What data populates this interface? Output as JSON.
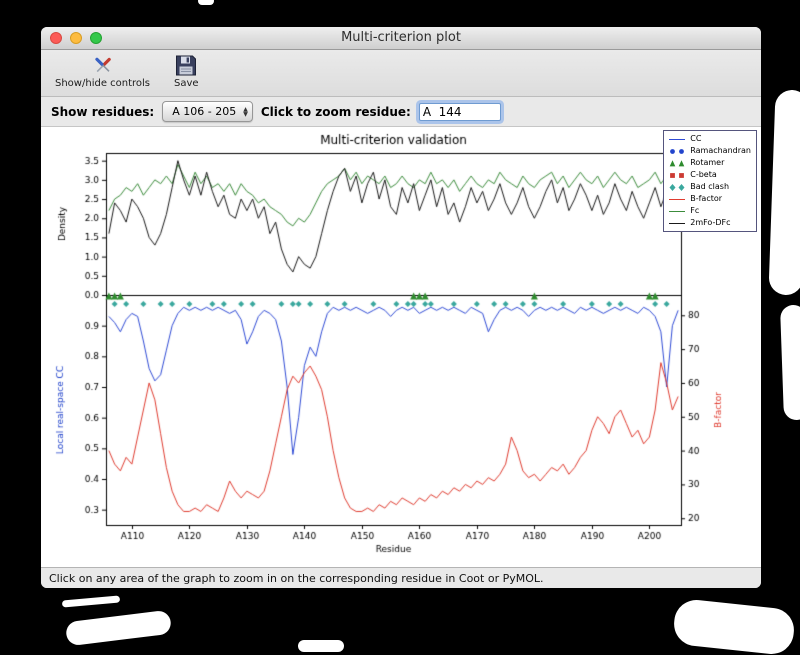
{
  "window": {
    "title": "Multi-criterion plot",
    "toolbar": {
      "show_hide_label": "Show/hide controls",
      "save_label": "Save"
    },
    "controls": {
      "show_residues_label": "Show residues:",
      "residue_range_value": "A 106 - 205",
      "zoom_label": "Click to zoom residue:",
      "zoom_value": "A  144"
    },
    "status_text": "Click on any area of the graph to zoom in on the corresponding residue in Coot or PyMOL."
  },
  "chart_data": {
    "type": "line",
    "title": "Multi-criterion validation",
    "xlabel": "Residue",
    "x_start": 106,
    "x_step": 1,
    "xlim": [
      105.5,
      205.5
    ],
    "x_tick_values": [
      110,
      120,
      130,
      140,
      150,
      160,
      170,
      180,
      190,
      200
    ],
    "x_tick_labels": [
      "A110",
      "A120",
      "A130",
      "A140",
      "A150",
      "A160",
      "A170",
      "A180",
      "A190",
      "A200"
    ],
    "grid": false,
    "legend_position": "upper-right-outside",
    "top_panel": {
      "ylabel": "Density",
      "ylim": [
        0.0,
        3.7
      ],
      "yticks": [
        0.0,
        0.5,
        1.0,
        1.5,
        2.0,
        2.5,
        3.0,
        3.5
      ],
      "series": [
        {
          "name": "Fc",
          "color": "#3c8c3c",
          "values": [
            2.2,
            2.5,
            2.6,
            2.8,
            2.7,
            2.9,
            2.6,
            2.8,
            3.0,
            2.9,
            3.1,
            2.9,
            3.4,
            3.1,
            2.8,
            3.2,
            2.9,
            3.1,
            2.8,
            2.9,
            2.7,
            2.9,
            2.6,
            2.9,
            2.7,
            2.6,
            2.4,
            2.5,
            2.3,
            2.2,
            2.1,
            1.9,
            1.8,
            2.0,
            1.9,
            2.1,
            2.4,
            2.7,
            2.9,
            3.0,
            3.1,
            3.3,
            3.0,
            3.2,
            2.9,
            3.1,
            3.0,
            2.9,
            3.1,
            2.8,
            2.9,
            3.1,
            2.9,
            2.8,
            3.0,
            2.9,
            3.2,
            2.9,
            3.0,
            2.8,
            3.0,
            2.7,
            2.9,
            3.1,
            2.9,
            2.8,
            3.0,
            2.9,
            3.2,
            3.0,
            2.9,
            2.8,
            3.1,
            2.9,
            2.8,
            3.0,
            3.1,
            3.2,
            2.9,
            3.1,
            2.8,
            3.0,
            3.2,
            3.0,
            2.9,
            3.1,
            2.8,
            3.0,
            3.2,
            3.0,
            2.9,
            3.1,
            2.8,
            2.9,
            3.0,
            3.2,
            2.9,
            3.1,
            2.9,
            3.0
          ]
        },
        {
          "name": "2mFo-DFc",
          "color": "#1a1a1a",
          "values": [
            1.6,
            2.4,
            2.2,
            1.9,
            2.5,
            2.3,
            2.0,
            1.5,
            1.3,
            1.6,
            2.1,
            2.8,
            3.5,
            3.0,
            2.6,
            3.1,
            2.6,
            3.2,
            2.7,
            2.3,
            2.6,
            2.1,
            2.0,
            2.5,
            2.2,
            2.5,
            2.0,
            2.3,
            1.6,
            1.9,
            1.2,
            0.8,
            0.6,
            1.0,
            0.8,
            0.7,
            1.0,
            1.6,
            2.2,
            2.7,
            3.1,
            3.3,
            2.7,
            3.1,
            2.4,
            2.9,
            3.2,
            2.5,
            3.0,
            2.3,
            2.1,
            2.8,
            2.4,
            2.9,
            2.2,
            2.6,
            3.0,
            2.3,
            2.8,
            2.1,
            2.4,
            1.9,
            2.3,
            2.8,
            2.4,
            2.7,
            2.2,
            2.5,
            2.9,
            2.4,
            2.1,
            2.4,
            2.8,
            2.3,
            2.0,
            2.3,
            2.7,
            3.0,
            2.4,
            2.8,
            2.2,
            2.5,
            2.9,
            2.6,
            2.2,
            2.6,
            2.1,
            2.4,
            2.9,
            2.5,
            2.2,
            2.7,
            2.3,
            2.0,
            2.4,
            2.8,
            2.3,
            2.7,
            2.2,
            2.5
          ]
        }
      ]
    },
    "bottom_panel": {
      "ylabel_left": "Local real-space CC",
      "ylabel_left_color": "#2244cc",
      "ylim_left": [
        0.25,
        1.0
      ],
      "yticks_left": [
        0.3,
        0.4,
        0.5,
        0.6,
        0.7,
        0.8,
        0.9
      ],
      "ylabel_right": "B-factor",
      "ylabel_right_color": "#e03c30",
      "ylim_right": [
        18,
        86
      ],
      "yticks_right": [
        20,
        30,
        40,
        50,
        60,
        70,
        80
      ],
      "series": [
        {
          "name": "CC",
          "axis": "left",
          "color": "#2f4bd6",
          "values": [
            0.93,
            0.91,
            0.88,
            0.92,
            0.94,
            0.93,
            0.85,
            0.76,
            0.72,
            0.74,
            0.82,
            0.9,
            0.94,
            0.96,
            0.95,
            0.96,
            0.95,
            0.96,
            0.95,
            0.96,
            0.95,
            0.94,
            0.95,
            0.92,
            0.84,
            0.88,
            0.93,
            0.95,
            0.94,
            0.92,
            0.85,
            0.7,
            0.48,
            0.6,
            0.77,
            0.83,
            0.8,
            0.88,
            0.94,
            0.96,
            0.95,
            0.96,
            0.95,
            0.96,
            0.95,
            0.94,
            0.95,
            0.96,
            0.95,
            0.93,
            0.95,
            0.96,
            0.95,
            0.96,
            0.94,
            0.95,
            0.96,
            0.95,
            0.96,
            0.95,
            0.96,
            0.95,
            0.94,
            0.96,
            0.95,
            0.94,
            0.88,
            0.92,
            0.95,
            0.96,
            0.95,
            0.96,
            0.95,
            0.93,
            0.95,
            0.96,
            0.95,
            0.96,
            0.95,
            0.96,
            0.95,
            0.94,
            0.96,
            0.95,
            0.96,
            0.95,
            0.94,
            0.95,
            0.96,
            0.95,
            0.96,
            0.95,
            0.94,
            0.96,
            0.95,
            0.93,
            0.88,
            0.7,
            0.9,
            0.95
          ]
        },
        {
          "name": "B-factor",
          "axis": "right",
          "color": "#e03c30",
          "values": [
            40,
            36,
            34,
            38,
            36,
            44,
            52,
            60,
            55,
            45,
            35,
            28,
            24,
            22,
            22,
            23,
            22,
            24,
            23,
            22,
            26,
            31,
            28,
            26,
            28,
            27,
            26,
            28,
            34,
            42,
            50,
            58,
            62,
            60,
            63,
            65,
            62,
            58,
            50,
            40,
            32,
            26,
            23,
            22,
            22,
            23,
            22,
            24,
            23,
            25,
            24,
            26,
            25,
            24,
            26,
            25,
            27,
            26,
            28,
            27,
            29,
            28,
            30,
            29,
            31,
            30,
            32,
            31,
            33,
            36,
            44,
            40,
            34,
            32,
            33,
            31,
            33,
            35,
            34,
            36,
            33,
            35,
            38,
            40,
            46,
            50,
            48,
            45,
            50,
            52,
            48,
            44,
            46,
            42,
            44,
            52,
            66,
            60,
            52,
            56
          ]
        }
      ],
      "markers": [
        {
          "name": "Bad clash",
          "shape": "diamond",
          "color": "#3aa89e",
          "x": [
            107,
            109,
            112,
            115,
            117,
            120,
            124,
            126,
            129,
            131,
            136,
            138,
            139,
            141,
            144,
            147,
            152,
            156,
            158,
            159,
            161,
            162,
            166,
            170,
            173,
            175,
            178,
            180,
            185,
            190,
            193,
            195,
            201,
            203
          ]
        },
        {
          "name": "Rotamer",
          "shape": "triangle",
          "color": "#2e8b2e",
          "x": [
            106,
            107,
            108,
            159,
            160,
            161,
            180,
            200,
            201
          ]
        }
      ]
    },
    "legend": {
      "items": [
        {
          "label": "CC",
          "type": "line",
          "color": "#2f4bd6"
        },
        {
          "label": "Ramachandran",
          "type": "circle",
          "color": "#2244cc"
        },
        {
          "label": "Rotamer",
          "type": "triangle",
          "color": "#2e8b2e"
        },
        {
          "label": "C-beta",
          "type": "square",
          "color": "#cc3b33"
        },
        {
          "label": "Bad clash",
          "type": "diamond",
          "color": "#3aa89e"
        },
        {
          "label": "B-factor",
          "type": "line",
          "color": "#e03c30"
        },
        {
          "label": "Fc",
          "type": "line",
          "color": "#3c8c3c"
        },
        {
          "label": "2mFo-DFc",
          "type": "line",
          "color": "#1a1a1a"
        }
      ]
    }
  }
}
